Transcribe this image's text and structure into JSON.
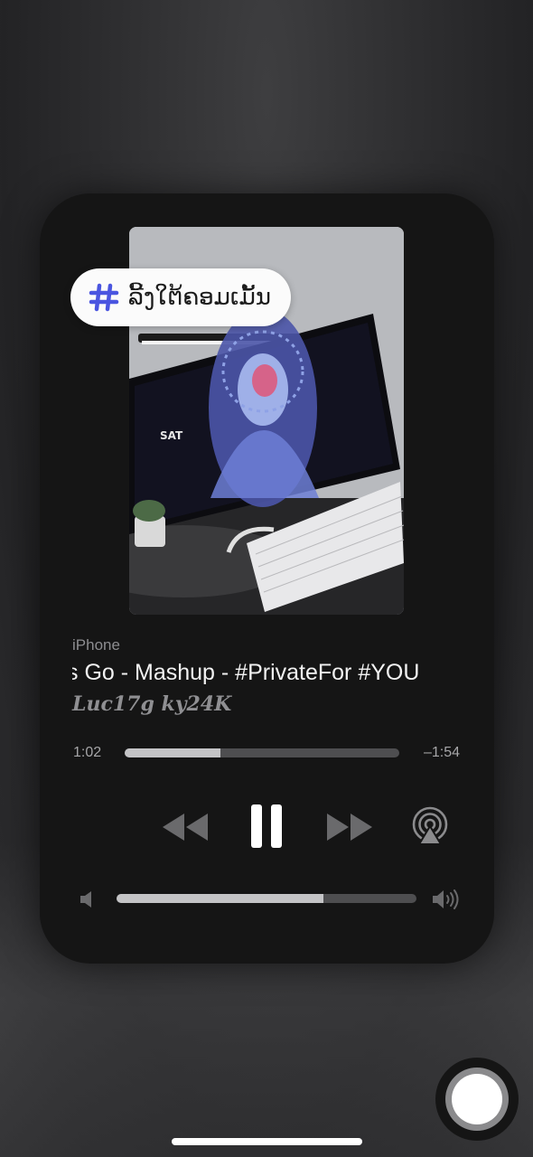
{
  "tag": {
    "text": "ລີ້ງໃຕ້ຄອມເມັ້ນ",
    "icon": "hashtag-icon",
    "icon_color": "#4a55e0"
  },
  "now_playing": {
    "source": "iPhone",
    "title": "s Go - Mashup - #PrivateFor #YOU",
    "artist": "Luc17g ky24K",
    "elapsed": "1:02",
    "remaining": "–1:54",
    "progress": 0.35
  },
  "controls": {
    "rewind": "rewind-icon",
    "pause": "pause-icon",
    "fast_forward": "fast-forward-icon",
    "airplay": "airplay-icon"
  },
  "volume": {
    "level": 0.69,
    "low_icon": "speaker-low-icon",
    "high_icon": "speaker-high-icon"
  },
  "artwork": {
    "screen_text": "SAT"
  },
  "colors": {
    "accent": "#4a55e0",
    "panel": "#151515",
    "track": "#4e4e50",
    "fill": "#c4c4c6"
  }
}
